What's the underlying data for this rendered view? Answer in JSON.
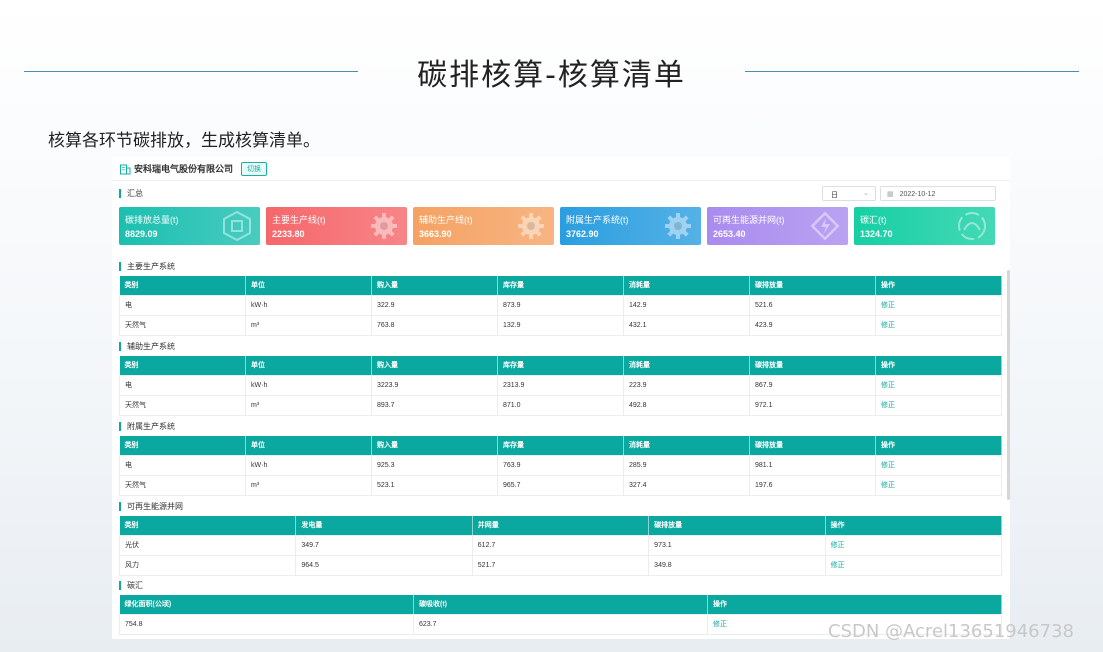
{
  "slide": {
    "title": "碳排核算-核算清单",
    "subtitle": "核算各环节碳排放，生成核算清单。"
  },
  "company": {
    "name": "安科瑞电气股份有限公司",
    "switch_label": "切换"
  },
  "summary": {
    "title": "汇总",
    "period_select": "日",
    "date": "2022-10-12",
    "cards": [
      {
        "label": "碳排放总量(t)",
        "value": "8829.09",
        "icon": "carbon-icon",
        "color": "#1bbfb0"
      },
      {
        "label": "主要生产线(t)",
        "value": "2233.80",
        "icon": "gear-icon",
        "color": "#f5676a"
      },
      {
        "label": "辅助生产线(t)",
        "value": "3663.90",
        "icon": "gear-icon",
        "color": "#f5a263"
      },
      {
        "label": "附属生产系统(t)",
        "value": "3762.90",
        "icon": "gear-icon",
        "color": "#2a9ee0"
      },
      {
        "label": "可再生能源并网(t)",
        "value": "2653.40",
        "icon": "power-icon",
        "color": "#a98bef"
      },
      {
        "label": "碳汇(t)",
        "value": "1324.70",
        "icon": "carbon-sink-icon",
        "color": "#16cfa4"
      }
    ]
  },
  "sections": [
    {
      "title": "主要生产系统",
      "headers": [
        "类别",
        "单位",
        "购入量",
        "库存量",
        "消耗量",
        "碳排放量",
        "操作"
      ],
      "rows": [
        [
          "电",
          "kW·h",
          "322.9",
          "873.9",
          "142.9",
          "521.6",
          "修正"
        ],
        [
          "天然气",
          "m³",
          "763.8",
          "132.9",
          "432.1",
          "423.9",
          "修正"
        ]
      ]
    },
    {
      "title": "辅助生产系统",
      "headers": [
        "类别",
        "单位",
        "购入量",
        "库存量",
        "消耗量",
        "碳排放量",
        "操作"
      ],
      "rows": [
        [
          "电",
          "kW·h",
          "3223.9",
          "2313.9",
          "223.9",
          "867.9",
          "修正"
        ],
        [
          "天然气",
          "m³",
          "893.7",
          "871.0",
          "492.8",
          "972.1",
          "修正"
        ]
      ]
    },
    {
      "title": "附属生产系统",
      "headers": [
        "类别",
        "单位",
        "购入量",
        "库存量",
        "消耗量",
        "碳排放量",
        "操作"
      ],
      "rows": [
        [
          "电",
          "kW·h",
          "925.3",
          "763.9",
          "285.9",
          "981.1",
          "修正"
        ],
        [
          "天然气",
          "m³",
          "523.1",
          "965.7",
          "327.4",
          "197.6",
          "修正"
        ]
      ]
    },
    {
      "title": "可再生能源并网",
      "headers": [
        "类别",
        "发电量",
        "并网量",
        "碳排放量",
        "操作"
      ],
      "rows": [
        [
          "光伏",
          "349.7",
          "612.7",
          "973.1",
          "修正"
        ],
        [
          "风力",
          "964.5",
          "521.7",
          "349.8",
          "修正"
        ]
      ]
    },
    {
      "title": "碳汇",
      "headers": [
        "绿化面积(公顷)",
        "碳吸收(t)",
        "操作"
      ],
      "rows": [
        [
          "754.8",
          "623.7",
          "修正"
        ]
      ]
    }
  ],
  "watermark": "CSDN @Acrel13651946738"
}
